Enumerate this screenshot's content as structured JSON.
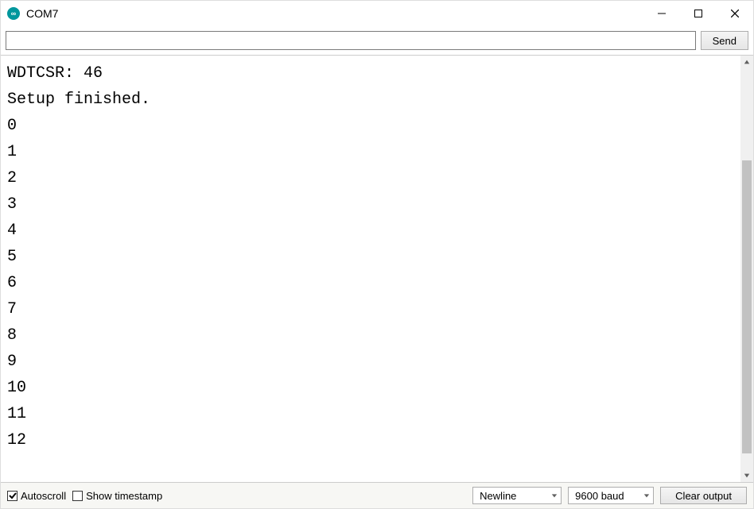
{
  "window": {
    "title": "COM7",
    "icon_glyph": "∞"
  },
  "send": {
    "value": "",
    "placeholder": "",
    "button_label": "Send"
  },
  "output_lines": [
    "WDTCSR: 46",
    "Setup finished.",
    "0",
    "1",
    "2",
    "3",
    "4",
    "5",
    "6",
    "7",
    "8",
    "9",
    "10",
    "11",
    "12"
  ],
  "footer": {
    "autoscroll_label": "Autoscroll",
    "autoscroll_checked": true,
    "timestamp_label": "Show timestamp",
    "timestamp_checked": false,
    "line_ending_selected": "Newline",
    "baud_selected": "9600 baud",
    "clear_label": "Clear output"
  }
}
